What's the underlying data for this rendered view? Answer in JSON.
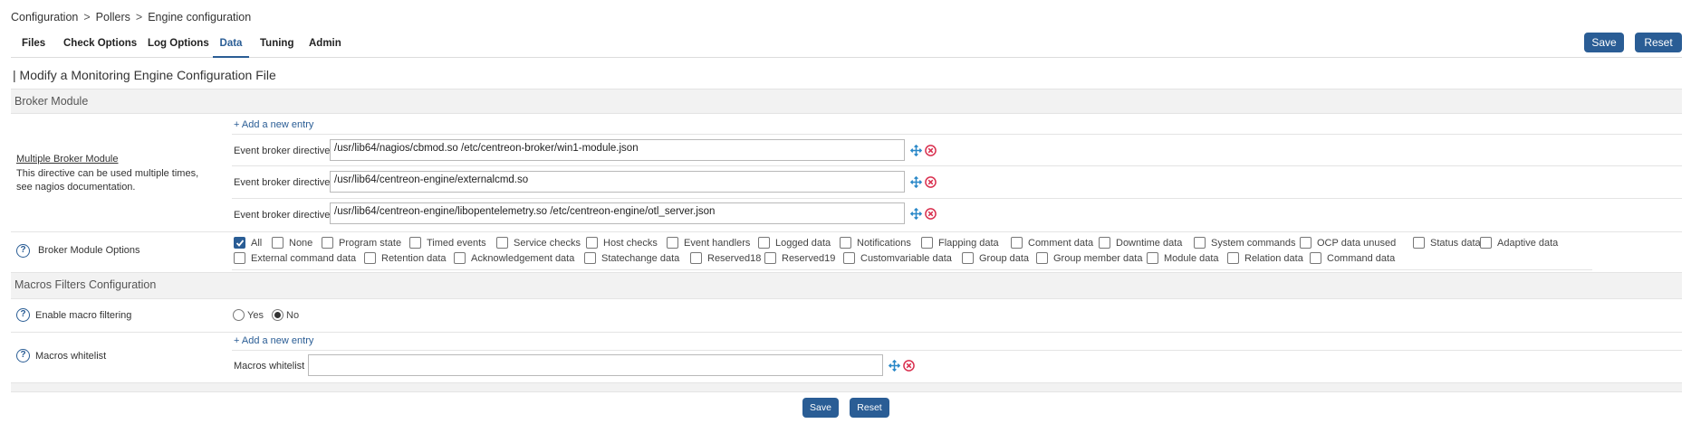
{
  "breadcrumb": [
    "Configuration",
    "Pollers",
    "Engine configuration"
  ],
  "breadcrumb_sep": ">",
  "tabs": [
    "Files",
    "Check Options",
    "Log Options",
    "Data",
    "Tuning",
    "Admin"
  ],
  "active_tab": "Data",
  "top_buttons": {
    "save": "Save",
    "reset": "Reset"
  },
  "page_title": "| Modify a Monitoring Engine Configuration File",
  "sections": {
    "broker": "Broker Module",
    "macros": "Macros Filters Configuration"
  },
  "broker": {
    "add_entry": "+ Add a new entry",
    "label_title": "Multiple Broker Module",
    "label_desc_1": "This directive can be used multiple times,",
    "label_desc_2": "see nagios documentation.",
    "directive_label": "Event broker directive",
    "directives": [
      "/usr/lib64/nagios/cbmod.so /etc/centreon-broker/win1-module.json",
      "/usr/lib64/centreon-engine/externalcmd.so",
      "/usr/lib64/centreon-engine/libopentelemetry.so /etc/centreon-engine/otl_server.json"
    ]
  },
  "broker_options": {
    "label": "Broker Module Options",
    "row1": [
      "All",
      "None",
      "Program state",
      "Timed events",
      "Service checks",
      "Host checks",
      "Event handlers",
      "Logged data",
      "Notifications",
      "Flapping data",
      "Comment data",
      "Downtime data",
      "System commands",
      "OCP data unused",
      "Status data",
      "Adaptive data"
    ],
    "row2": [
      "External command data",
      "Retention data",
      "Acknowledgement data",
      "Statechange data",
      "Reserved18",
      "Reserved19",
      "Customvariable data",
      "Group data",
      "Group member data",
      "Module data",
      "Relation data",
      "Command data"
    ],
    "checked": [
      "All"
    ]
  },
  "macro_filtering": {
    "label": "Enable macro filtering",
    "yes": "Yes",
    "no": "No",
    "selected": "No"
  },
  "macros_whitelist": {
    "label": "Macros whitelist",
    "add_entry": "+ Add a new entry",
    "field_label": "Macros whitelist",
    "value": ""
  },
  "bottom_buttons": {
    "save": "Save",
    "reset": "Reset"
  },
  "colors": {
    "accent": "#2a5d95",
    "delete": "#d9304f",
    "move": "#2a88c8"
  }
}
